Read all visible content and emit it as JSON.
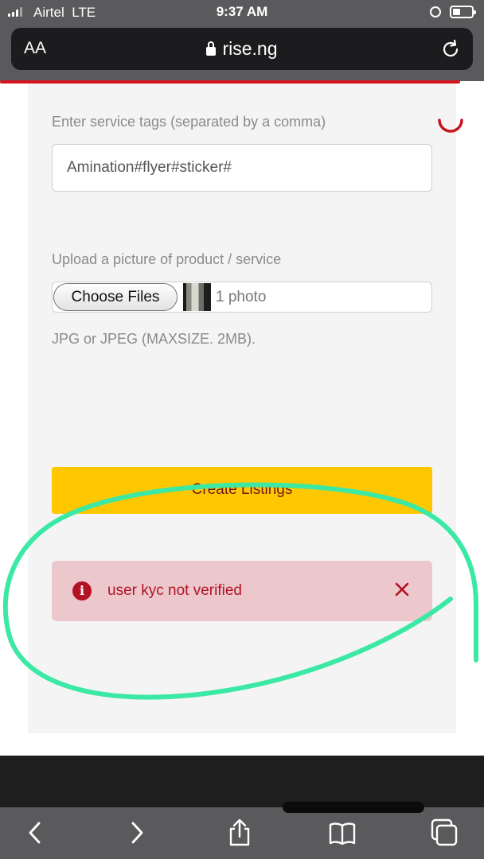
{
  "status_bar": {
    "carrier": "Airtel",
    "network": "LTE",
    "time": "9:37 AM"
  },
  "browser": {
    "text_size_label": "AA",
    "url": "rise.ng"
  },
  "form": {
    "tags_label": "Enter service tags (separated by a comma)",
    "tags_value": "Amination#flyer#sticker#",
    "upload_label": "Upload a picture of product / service",
    "choose_button": "Choose Files",
    "file_count": "1 photo",
    "file_hint": "JPG or JPEG (MAXSIZE. 2MB).",
    "submit_label": "Create Listings"
  },
  "alert": {
    "message": "user kyc not verified",
    "color": "#b31224",
    "background": "#ecc8cc"
  },
  "colors": {
    "accent": "#ffc700",
    "progress": "#d4151f",
    "annotation": "#3be8a4"
  },
  "toolbar": {
    "icons": [
      "back-icon",
      "forward-icon",
      "share-icon",
      "bookmarks-icon",
      "tabs-icon"
    ]
  }
}
